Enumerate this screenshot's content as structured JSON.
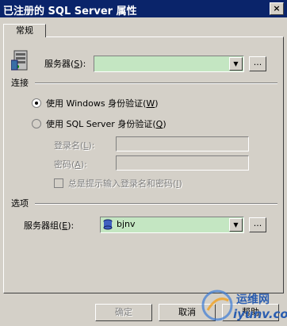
{
  "window": {
    "title": "已注册的 SQL Server 属性",
    "close_label": "×"
  },
  "tabs": [
    {
      "label": "常规"
    }
  ],
  "server": {
    "label": "服务器",
    "accel": "S",
    "value": "",
    "browse_label": "..."
  },
  "connection": {
    "header": "连接",
    "windows_auth": {
      "label": "使用 Windows 身份验证",
      "accel": "W",
      "selected": true
    },
    "sql_auth": {
      "label": "使用 SQL Server 身份验证",
      "accel": "Q",
      "selected": false
    },
    "login": {
      "label": "登录名",
      "accel": "L",
      "value": ""
    },
    "password": {
      "label": "密码",
      "accel": "A",
      "value": ""
    },
    "always_prompt": {
      "label": "总是提示输入登录名和密码",
      "accel": "I",
      "checked": false,
      "enabled": false
    }
  },
  "options": {
    "header": "选项",
    "server_group": {
      "label": "服务器组",
      "accel": "E",
      "value": "bjnv",
      "browse_label": "..."
    }
  },
  "buttons": {
    "ok": "确定",
    "cancel": "取消",
    "help": "帮助"
  },
  "watermark": {
    "cn": "运维网",
    "en": "iyunv.com"
  }
}
